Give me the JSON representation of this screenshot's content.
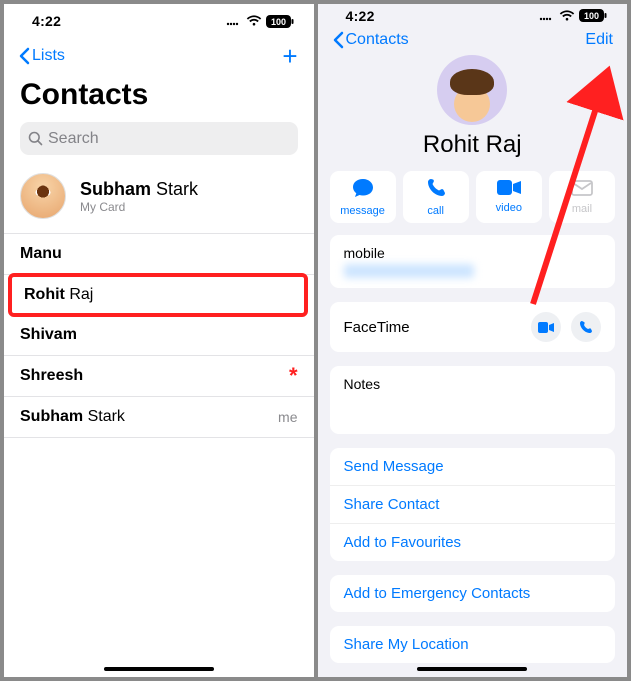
{
  "statusbar": {
    "time": "4:22",
    "battery": "100"
  },
  "left": {
    "back": "Lists",
    "title": "Contacts",
    "search_placeholder": "Search",
    "mycard": {
      "name_first": "Subham",
      "name_last": "Stark",
      "subtitle": "My Card"
    },
    "contacts": [
      {
        "first": "Manu",
        "last": "",
        "trail": "",
        "highlighted": false
      },
      {
        "first": "Rohit",
        "last": "Raj",
        "trail": "",
        "highlighted": true
      },
      {
        "first": "Shivam",
        "last": "",
        "trail": "",
        "highlighted": false
      },
      {
        "first": "Shreesh",
        "last": "",
        "trail": "star",
        "highlighted": false
      },
      {
        "first": "Subham",
        "last": "Stark",
        "trail": "me",
        "highlighted": false
      }
    ]
  },
  "right": {
    "back": "Contacts",
    "edit": "Edit",
    "name": "Rohit Raj",
    "actions": [
      {
        "key": "message",
        "label": "message",
        "disabled": false
      },
      {
        "key": "call",
        "label": "call",
        "disabled": false
      },
      {
        "key": "video",
        "label": "video",
        "disabled": false
      },
      {
        "key": "mail",
        "label": "mail",
        "disabled": true
      }
    ],
    "phone_label": "mobile",
    "facetime": "FaceTime",
    "notes": "Notes",
    "links1": [
      "Send Message",
      "Share Contact",
      "Add to Favourites"
    ],
    "links2": [
      "Add to Emergency Contacts"
    ],
    "links3": [
      "Share My Location"
    ]
  },
  "colors": {
    "accent": "#007aff",
    "annotation": "#ff2020"
  }
}
